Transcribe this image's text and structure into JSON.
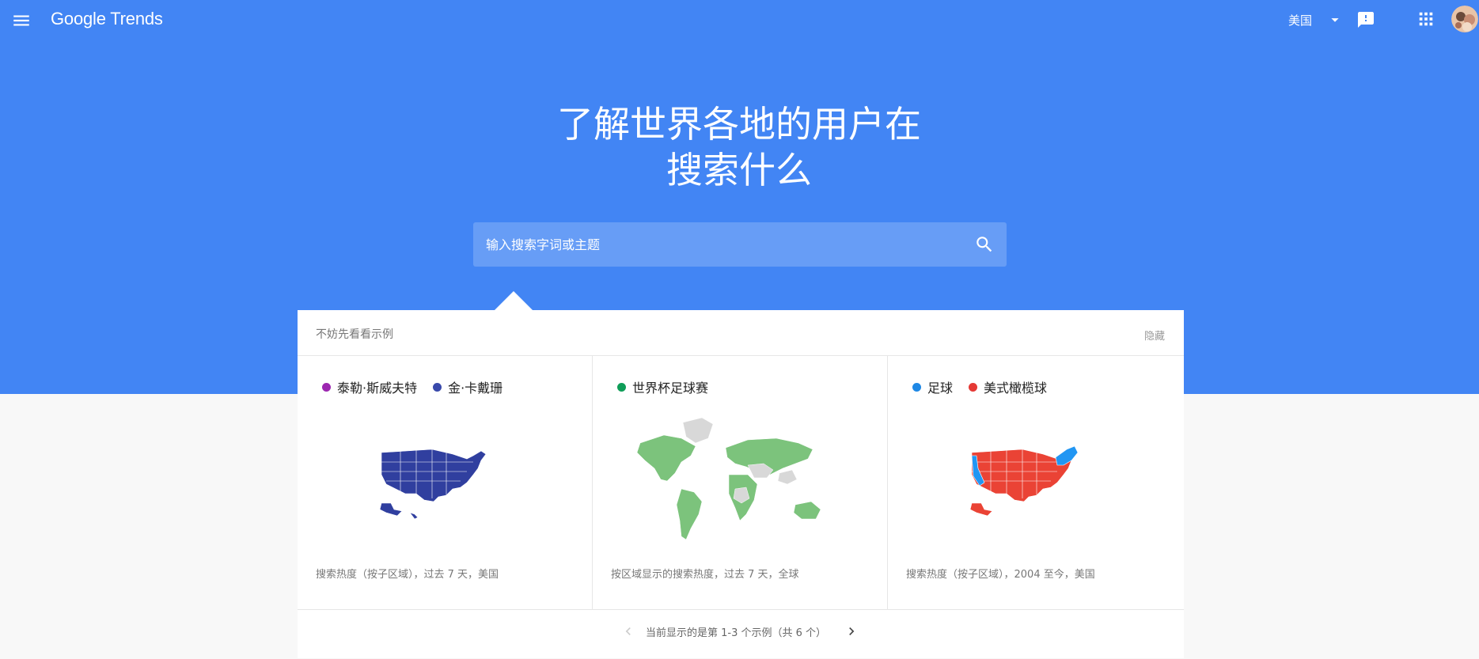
{
  "header": {
    "logo": "Google Trends",
    "region": "美国",
    "icons": {
      "menu": "menu-icon",
      "region_caret": "caret-down-icon",
      "feedback": "feedback-icon",
      "apps": "apps-grid-icon"
    }
  },
  "hero": {
    "headline_line1": "了解世界各地的用户在",
    "headline_line2": "搜索什么",
    "search_placeholder": "输入搜索字词或主题"
  },
  "examples": {
    "title": "不妨先看看示例",
    "hide_label": "隐藏",
    "cards": [
      {
        "legend": [
          {
            "label": "泰勒·斯威夫特",
            "color": "#9c27b0"
          },
          {
            "label": "金·卡戴珊",
            "color": "#3949ab"
          }
        ],
        "map": "us-map",
        "caption": "搜索热度（按子区域），过去 7 天，美国"
      },
      {
        "legend": [
          {
            "label": "世界杯足球赛",
            "color": "#0f9d58"
          }
        ],
        "map": "world-map",
        "caption": "按区域显示的搜索热度，过去 7 天，全球"
      },
      {
        "legend": [
          {
            "label": "足球",
            "color": "#1e88e5"
          },
          {
            "label": "美式橄榄球",
            "color": "#e53935"
          }
        ],
        "map": "us-map",
        "caption": "搜索热度（按子区域），2004 至今，美国"
      }
    ],
    "pager_text": "当前显示的是第 1-3 个示例（共 6 个）"
  },
  "colors": {
    "brand_blue": "#4285f4",
    "us_map_card1": "#303f9f",
    "world_green": "#7cc37c",
    "world_gray": "#d8d8d8",
    "us_map_card3_red": "#ea4335",
    "us_map_card3_blue": "#2196f3"
  }
}
